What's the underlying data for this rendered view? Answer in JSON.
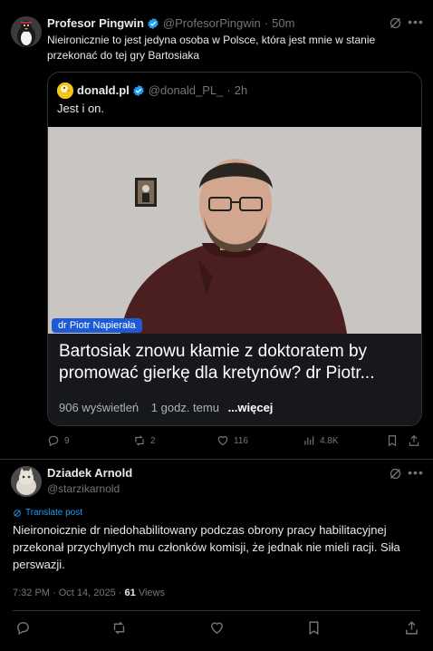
{
  "tweet1": {
    "author_name": "Profesor Pingwin",
    "author_handle": "@ProfesorPingwin",
    "separator": "·",
    "time": "50m",
    "text": "Nieironicznie to jest jedyna osoba w Polsce, która jest mnie w stanie przekonać do tej gry Bartosiaka",
    "quote": {
      "author_name": "donald.pl",
      "author_handle": "@donald_PL_",
      "time": "2h",
      "text": "Jest i on.",
      "video_badge": "dr Piotr Napierała",
      "card_title_line1": "Bartosiak znowu kłamie z doktoratem by",
      "card_title_line2": "promować gierkę dla kretynów? dr Piotr...",
      "card_views": "906 wyświetleń",
      "card_time": "1 godz. temu",
      "card_more": "...więcej"
    },
    "actions": {
      "replies": "9",
      "reposts": "2",
      "likes": "116",
      "views": "4.8K"
    }
  },
  "tweet2": {
    "author_name": "Dziadek Arnold",
    "author_handle": "@starzikarnold",
    "translate_label": "Translate post",
    "text": "Nieironoicznie dr niedohabilitowany podczas obrony pracy habilitacyjnej przekonał przychylnych mu członków komisji, że jednak nie mieli racji. Siła perswazji.",
    "timestamp": "7:32 PM · Oct 14, 2025 · ",
    "views_count": "61",
    "views_label": " Views"
  },
  "colors": {
    "background": "#000000",
    "text": "#e7e9ea",
    "muted": "#71767b",
    "accent": "#1d9bf0",
    "border": "#2f3336"
  }
}
